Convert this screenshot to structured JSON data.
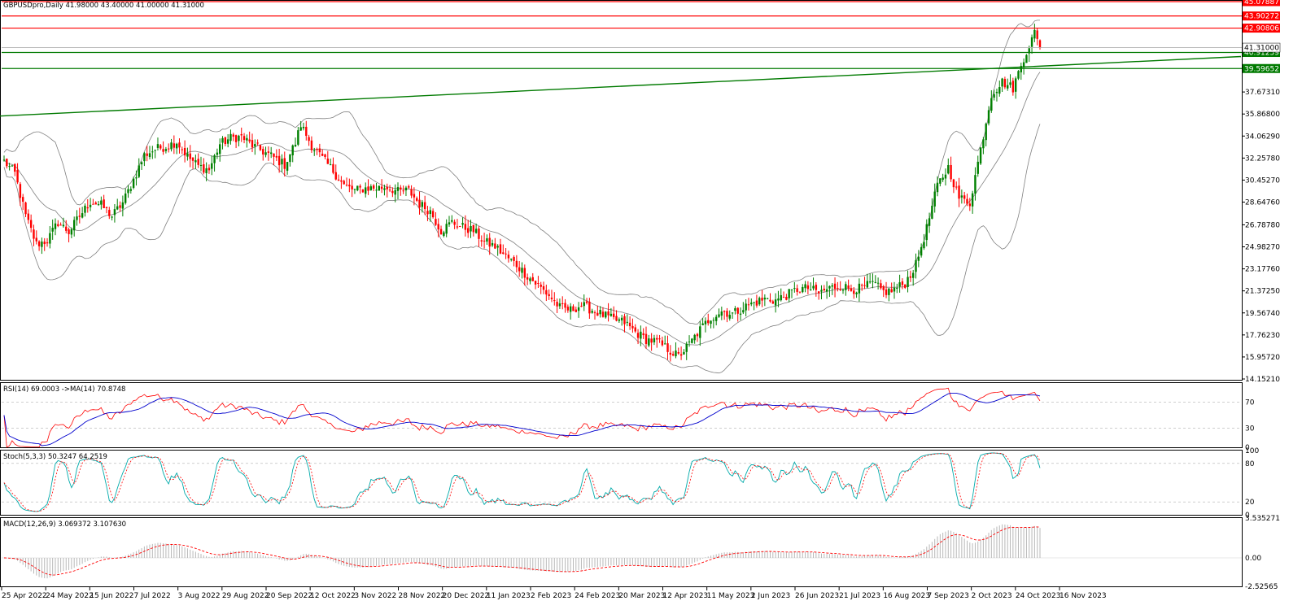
{
  "window": {
    "header": "GBPUSDpro,Daily  41.98000 43.40000 41.00000 41.31000"
  },
  "colors": {
    "bull": "#008000",
    "bear": "#ff0000",
    "resistance": "#ff0000",
    "support": "#007a00",
    "bands": "#808080",
    "rsi": "#ff0000",
    "rsi_ma": "#0000cd",
    "stoch_main": "#00aaaa",
    "stoch_signal": "#ff0000",
    "macd_hist": "#b8b8b8",
    "macd_signal": "#ff0000"
  },
  "chart_data": [
    {
      "type": "candlestick",
      "panel": "price",
      "ylim": [
        14.1521,
        45.07887
      ],
      "price_ticks": [
        "45.07887",
        "43.90272",
        "42.90806",
        "41.31000",
        "40.91259",
        "39.59652",
        "37.67310",
        "35.86800",
        "34.06290",
        "32.25780",
        "30.45270",
        "28.64760",
        "26.78780",
        "24.98270",
        "23.17760",
        "21.37250",
        "19.56740",
        "17.76230",
        "15.95720",
        "14.15210"
      ],
      "price_tick_values": [
        45.07887,
        43.90272,
        42.90806,
        41.31,
        40.91259,
        39.59652,
        37.6731,
        35.868,
        34.0629,
        32.2578,
        30.4527,
        28.6476,
        26.7878,
        24.9827,
        23.1776,
        21.3725,
        19.5674,
        17.7623,
        15.9572,
        14.1521
      ],
      "date_labels": [
        "25 Apr 2022",
        "24 May 2022",
        "15 Jun 2022",
        "7 Jul 2022",
        "3 Aug 2022",
        "29 Aug 2022",
        "20 Sep 2022",
        "12 Oct 2022",
        "3 Nov 2022",
        "28 Nov 2022",
        "20 Dec 2022",
        "11 Jan 2023",
        "2 Feb 2023",
        "24 Feb 2023",
        "20 Mar 2023",
        "12 Apr 2023",
        "11 May 2023",
        "2 Jun 2023",
        "26 Jun 2023",
        "21 Jul 2023",
        "16 Aug 2023",
        "7 Sep 2023",
        "2 Oct 2023",
        "24 Oct 2023",
        "16 Nov 2023"
      ],
      "bar_count": 330,
      "anchors": [
        [
          0,
          32.0
        ],
        [
          4,
          31.0
        ],
        [
          8,
          27.5
        ],
        [
          12,
          25.2
        ],
        [
          16,
          25.5
        ],
        [
          20,
          27.0
        ],
        [
          24,
          26.2
        ],
        [
          28,
          27.5
        ],
        [
          32,
          28.7
        ],
        [
          36,
          28.4
        ],
        [
          40,
          27.5
        ],
        [
          44,
          28.6
        ],
        [
          48,
          30.5
        ],
        [
          52,
          32.5
        ],
        [
          56,
          33.0
        ],
        [
          60,
          33.2
        ],
        [
          64,
          33.6
        ],
        [
          68,
          32.4
        ],
        [
          72,
          31.6
        ],
        [
          76,
          31.3
        ],
        [
          80,
          33.4
        ],
        [
          84,
          33.9
        ],
        [
          88,
          34.0
        ],
        [
          92,
          33.3
        ],
        [
          96,
          32.8
        ],
        [
          100,
          32.3
        ],
        [
          104,
          31.7
        ],
        [
          108,
          33.5
        ],
        [
          110,
          35.0
        ],
        [
          114,
          33.3
        ],
        [
          118,
          32.2
        ],
        [
          122,
          31.2
        ],
        [
          126,
          30.0
        ],
        [
          130,
          29.6
        ],
        [
          134,
          29.8
        ],
        [
          138,
          29.8
        ],
        [
          142,
          29.9
        ],
        [
          146,
          29.5
        ],
        [
          150,
          29.6
        ],
        [
          154,
          28.5
        ],
        [
          158,
          27.9
        ],
        [
          162,
          26.3
        ],
        [
          166,
          27.0
        ],
        [
          170,
          26.6
        ],
        [
          174,
          26.3
        ],
        [
          178,
          25.4
        ],
        [
          182,
          25.0
        ],
        [
          186,
          24.2
        ],
        [
          190,
          23.5
        ],
        [
          194,
          22.6
        ],
        [
          198,
          21.8
        ],
        [
          202,
          21.0
        ],
        [
          206,
          20.0
        ],
        [
          210,
          19.8
        ],
        [
          214,
          20.2
        ],
        [
          218,
          19.8
        ],
        [
          222,
          19.4
        ],
        [
          226,
          19.0
        ],
        [
          230,
          18.8
        ],
        [
          234,
          18.0
        ],
        [
          238,
          17.4
        ],
        [
          242,
          17.2
        ],
        [
          246,
          16.6
        ],
        [
          250,
          16.0
        ],
        [
          254,
          17.0
        ],
        [
          258,
          18.2
        ],
        [
          262,
          19.2
        ],
        [
          266,
          19.7
        ],
        [
          270,
          19.5
        ],
        [
          274,
          20.0
        ],
        [
          278,
          20.4
        ],
        [
          282,
          20.7
        ],
        [
          286,
          20.6
        ],
        [
          290,
          21.0
        ],
        [
          294,
          21.5
        ],
        [
          298,
          21.6
        ],
        [
          302,
          21.2
        ],
        [
          306,
          21.6
        ],
        [
          310,
          21.8
        ],
        [
          314,
          21.5
        ],
        [
          318,
          21.6
        ],
        [
          322,
          22.0
        ],
        [
          326,
          21.3
        ],
        [
          330,
          21.4
        ],
        [
          334,
          21.6
        ],
        [
          338,
          21.7
        ],
        [
          342,
          22.0
        ]
      ],
      "levels": {
        "resistance": [
          45.07887,
          43.90272,
          42.90806
        ],
        "support": [
          40.91259,
          39.59652
        ],
        "current": 41.31
      },
      "trendline": [
        [
          0,
          35.7
        ],
        [
          1525,
          40.58
        ]
      ]
    },
    {
      "type": "line",
      "panel": "rsi",
      "label": "RSI(14) 69.0003  ->MA(14) 70.8748",
      "ylim": [
        0,
        100
      ],
      "levels": [
        70,
        30
      ],
      "ticks": [
        "70",
        "30",
        "0"
      ],
      "tick_values": [
        70,
        30,
        0
      ]
    },
    {
      "type": "line",
      "panel": "stochastic",
      "label": "Stoch(5,3,3) 50.3247 64.2519",
      "ylim": [
        0,
        100
      ],
      "levels": [
        80,
        20
      ],
      "ticks": [
        "100",
        "80",
        "20",
        "0"
      ],
      "tick_values": [
        100,
        80,
        20,
        0
      ]
    },
    {
      "type": "bar",
      "panel": "macd",
      "label": "MACD(12,26,9) 3.069372 3.107630",
      "ylim": [
        -2.52565,
        3.535271
      ],
      "ticks": [
        "3.535271",
        "0.00",
        "-2.52565"
      ],
      "tick_values": [
        3.535271,
        0,
        -2.52565
      ]
    }
  ]
}
